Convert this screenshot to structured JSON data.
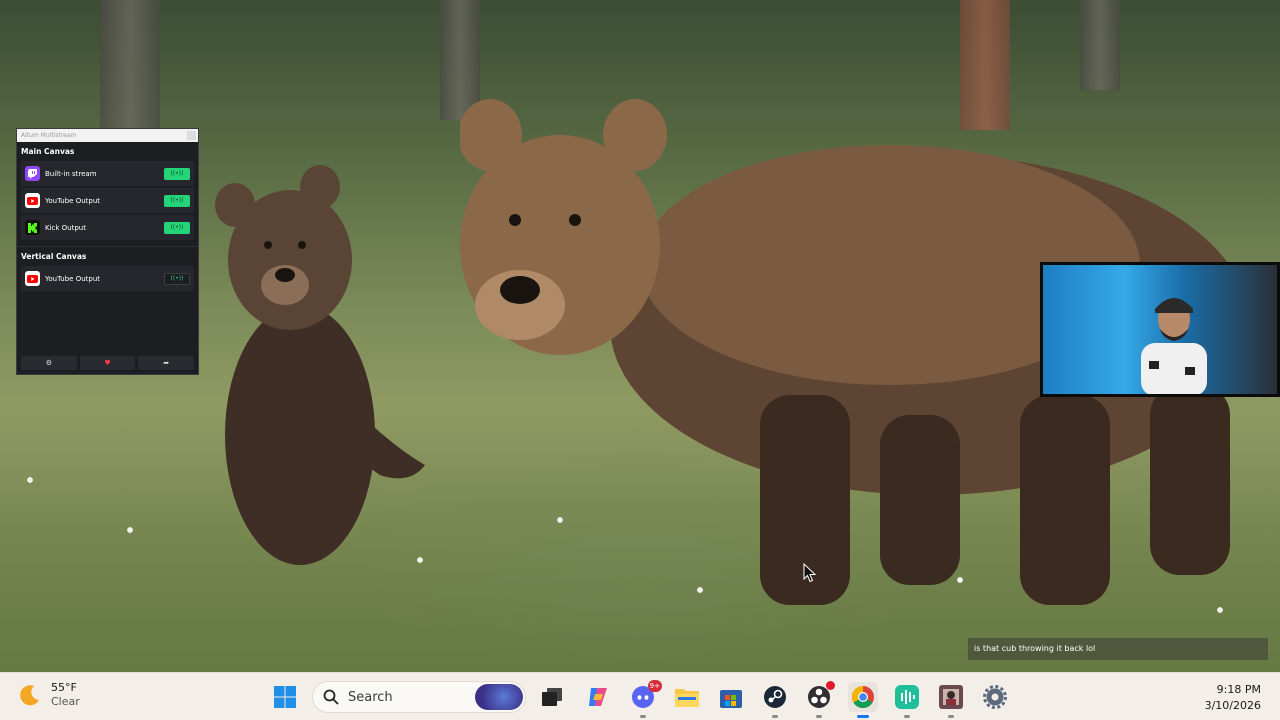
{
  "dock": {
    "title": "Aitum Multistream",
    "sections": [
      {
        "label": "Main Canvas",
        "outputs": [
          {
            "name": "Built-in stream",
            "platform": "twitch-icon",
            "active": true
          },
          {
            "name": "YouTube Output",
            "platform": "youtube-icon",
            "active": true
          },
          {
            "name": "Kick Output",
            "platform": "kick-icon",
            "active": true
          }
        ]
      },
      {
        "label": "Vertical Canvas",
        "outputs": [
          {
            "name": "YouTube Output",
            "platform": "youtube-icon",
            "active": false
          }
        ]
      }
    ],
    "footer": {
      "settings_icon": "gear-icon",
      "heart_icon": "heart-icon",
      "share_icon": "share-icon"
    },
    "colors": {
      "active_toggle": "#23d479",
      "background": "#1d1e22"
    }
  },
  "chat_overlay": {
    "message": "is that cub throwing it back lol"
  },
  "taskbar": {
    "weather": {
      "temp": "55°F",
      "condition": "Clear",
      "icon": "moon-icon"
    },
    "search": {
      "placeholder": "Search"
    },
    "apps": [
      {
        "name": "windows-start-icon"
      },
      {
        "name": "task-view-icon"
      },
      {
        "name": "copilot-icon"
      },
      {
        "name": "discord-icon",
        "badge": "9+"
      },
      {
        "name": "file-explorer-icon"
      },
      {
        "name": "microsoft-store-icon"
      },
      {
        "name": "steam-icon"
      },
      {
        "name": "obs-icon",
        "notification": true
      },
      {
        "name": "chrome-icon",
        "active": true
      },
      {
        "name": "audio-app-icon"
      },
      {
        "name": "game-app-icon"
      },
      {
        "name": "settings-icon"
      }
    ],
    "clock": {
      "time": "9:18 PM",
      "date": "3/10/2026"
    }
  }
}
